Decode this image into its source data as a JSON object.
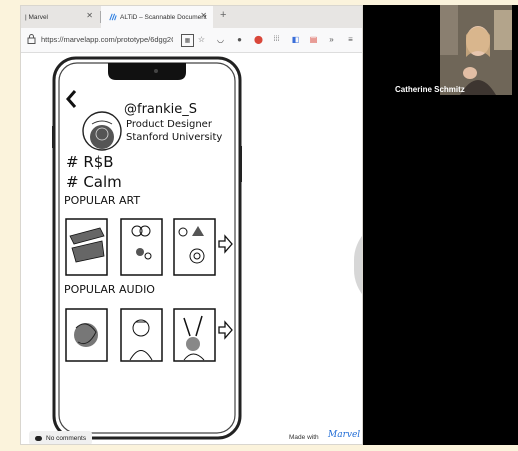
{
  "browser": {
    "tabs": [
      {
        "label": "| Marvel"
      },
      {
        "label": "ALTiD – Scannable Document"
      }
    ],
    "url": "https://marvelapp.com/prototype/6dgg2C"
  },
  "prototype": {
    "handle": "@frankie_S",
    "role": "Product Designer",
    "school": "Stanford University",
    "tags": [
      "# R$B",
      "# Calm"
    ],
    "section_art": "POPULAR ART",
    "section_audio": "POPULAR AUDIO"
  },
  "footer": {
    "comments_label": "No comments",
    "made_with": "Made with",
    "marvel_logo": "Marvel"
  },
  "video_call": {
    "participant_name": "Catherine Schmitz"
  }
}
